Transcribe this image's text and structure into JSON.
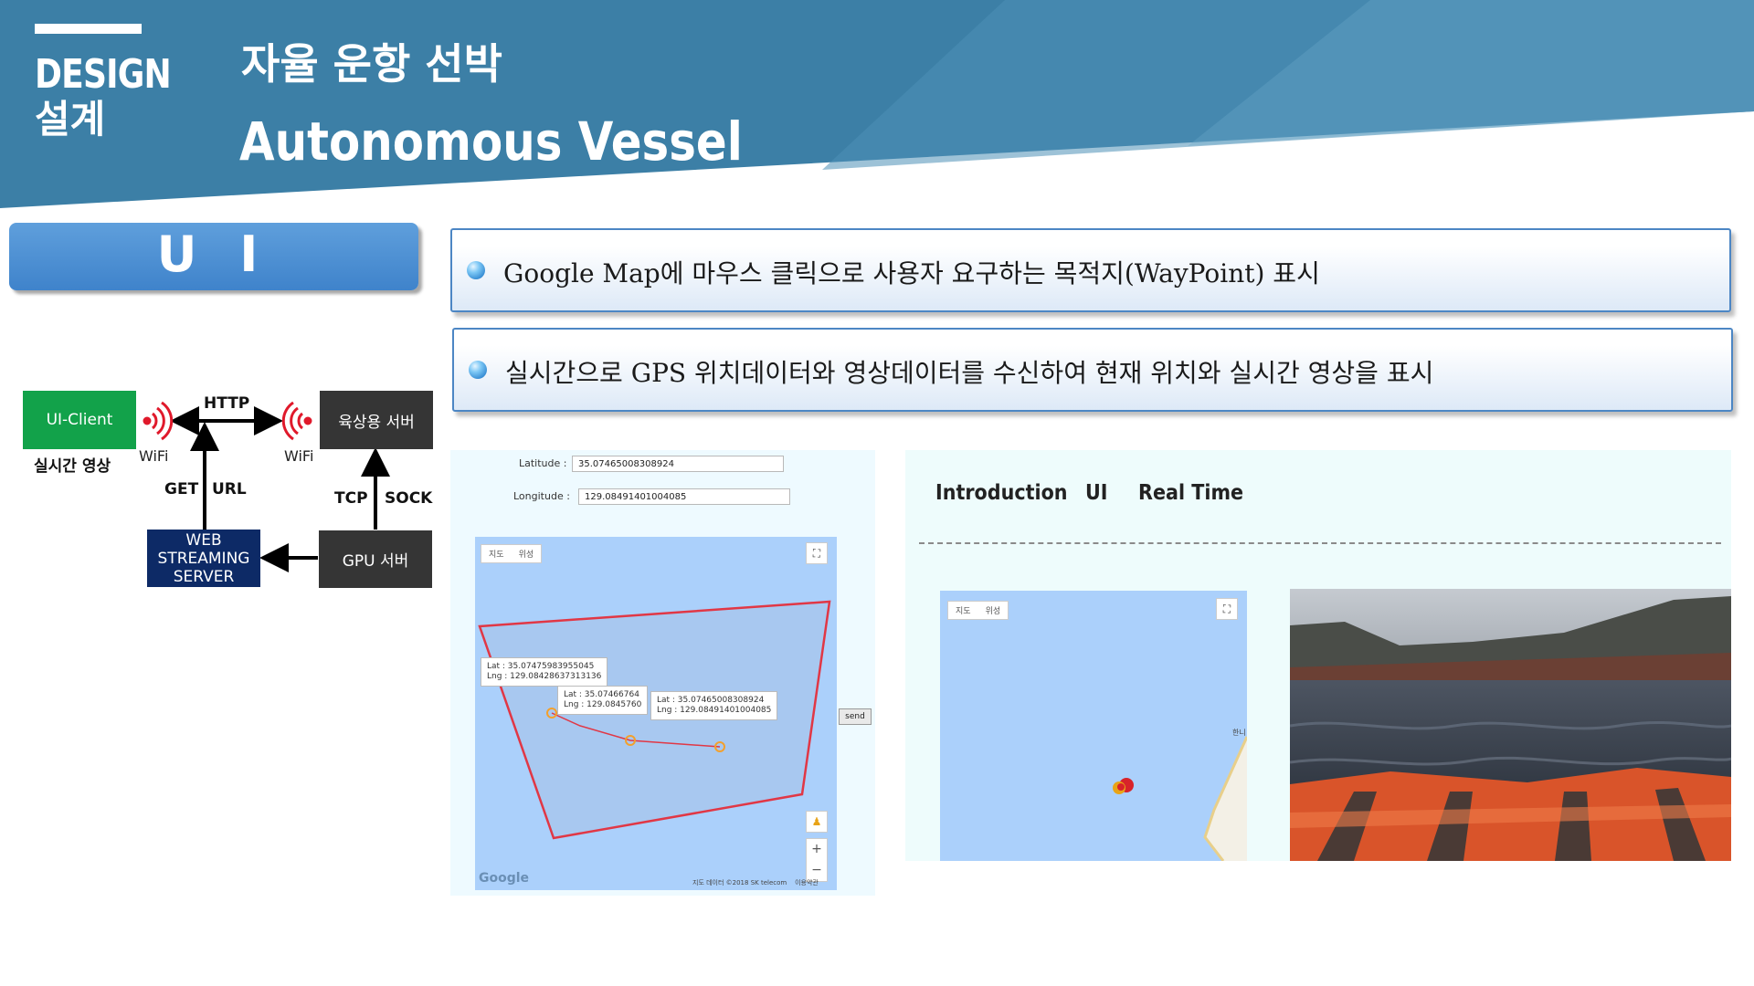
{
  "header": {
    "section_en": "DESIGN",
    "section_kr": "설계",
    "title_kr": "자율 운항 선박",
    "title_en": "Autonomous Vessel"
  },
  "ui_badge": "U I",
  "bullets": [
    "Google Map에 마우스 클릭으로 사용자 요구하는 목적지(WayPoint) 표시",
    "실시간으로 GPS 위치데이터와 영상데이터를 수신하여 현재 위치와 실시간 영상을 표시"
  ],
  "diagram": {
    "ui_client": "UI-Client",
    "ui_client_caption": "실시간 영상",
    "land_server": "육상용 서버",
    "gpu_server": "GPU 서버",
    "web_server_line1": "WEB",
    "web_server_line2": "STREAMING",
    "web_server_line3": "SERVER",
    "http": "HTTP",
    "wifi_left": "WiFi",
    "wifi_right": "WiFi",
    "get": "GET",
    "url": "URL",
    "tcp": "TCP",
    "sock": "SOCK"
  },
  "left_screenshot": {
    "latitude_label": "Latitude :",
    "latitude_value": "35.07465008308924",
    "longitude_label": "Longitude :",
    "longitude_value": "129.08491401004085",
    "map_tab_map": "지도",
    "map_tab_satellite": "위성",
    "info_1_lat": "Lat : 35.07475983955045",
    "info_1_lng": "Lng : 129.08428637313136",
    "info_2_lat": "Lat : 35.07466764",
    "info_2_lng": "Lng : 129.0845760",
    "info_3_lat": "Lat : 35.07465008308924",
    "info_3_lng": "Lng : 129.08491401004085",
    "close_symbol": "×",
    "send_label": "send",
    "google_logo": "Google",
    "map_footer": "지도 데이터 ©2018 SK telecom    이용약관",
    "zoom_in": "+",
    "zoom_out": "−"
  },
  "right_screenshot": {
    "nav": [
      "Introduction",
      "UI",
      "Real Time"
    ],
    "map_tab_map": "지도",
    "map_tab_satellite": "위성",
    "map_place_label": "한니"
  },
  "colors": {
    "header_blue": "#3c7fa6",
    "badge_blue": "#4a8fd4",
    "ui_client_green": "#12a24a",
    "server_dark": "#353535",
    "web_server_navy": "#0d2a66",
    "wifi_red": "#e0192b",
    "route_red": "#e13745"
  }
}
